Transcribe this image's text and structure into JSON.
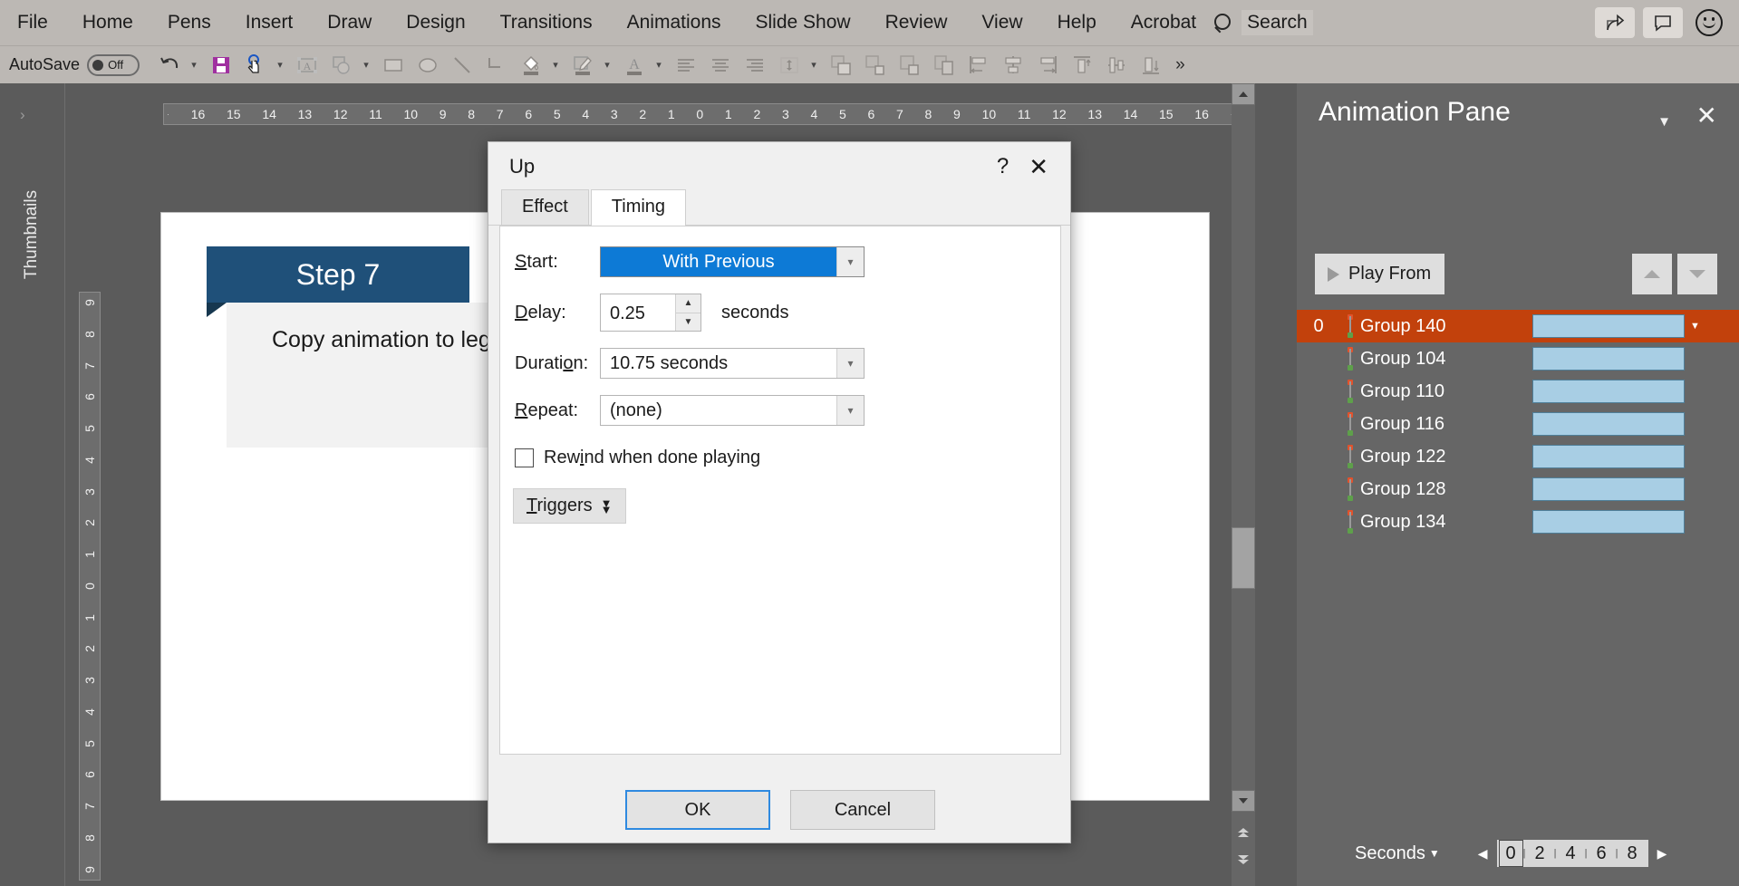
{
  "menu": {
    "items": [
      "File",
      "Home",
      "Pens",
      "Insert",
      "Draw",
      "Design",
      "Transitions",
      "Animations",
      "Slide Show",
      "Review",
      "View",
      "Help",
      "Acrobat"
    ],
    "search_label": "Search",
    "share_icon": "share-icon",
    "comment_icon": "comment-icon",
    "smiley_icon": "smiley-face-icon"
  },
  "toolbar": {
    "autosave_label": "AutoSave",
    "autosave_state": "Off",
    "icons": [
      "undo-icon",
      "save-icon",
      "pointer-hand-icon",
      "text-box-icon",
      "shapes-icon",
      "rectangle-icon",
      "ellipse-icon",
      "line-icon",
      "elbow-connector-icon",
      "shape-fill-icon",
      "shape-outline-icon",
      "text-color-icon",
      "align-left-icon",
      "align-center-icon",
      "align-right-icon",
      "line-spacing-icon",
      "group-icon",
      "bring-forward-icon",
      "send-backward-icon",
      "selection-pane-icon",
      "align-objects-left-icon",
      "align-objects-center-icon",
      "align-objects-right-icon",
      "align-top-icon",
      "align-middle-icon",
      "align-bottom-icon"
    ],
    "overflow_label": "»"
  },
  "left_rail": {
    "label": "Thumbnails",
    "expand_icon": "chevron-right-icon"
  },
  "rulers": {
    "horizontal": [
      "16",
      "15",
      "14",
      "13",
      "12",
      "11",
      "10",
      "9",
      "8",
      "7",
      "6",
      "5",
      "4",
      "3",
      "2",
      "1",
      "0",
      "1",
      "2",
      "3",
      "4",
      "5",
      "6",
      "7",
      "8",
      "9",
      "10",
      "11",
      "12",
      "13",
      "14",
      "15",
      "16"
    ],
    "vertical": [
      "9",
      "8",
      "7",
      "6",
      "5",
      "4",
      "3",
      "2",
      "1",
      "0",
      "1",
      "2",
      "3",
      "4",
      "5",
      "6",
      "7",
      "8",
      "9"
    ]
  },
  "slide": {
    "tag_title": "Step 7",
    "body_text": "Copy animation to legs",
    "tag_color": "#1f5079",
    "body_bg": "#f2f2f2"
  },
  "dialog": {
    "title": "Up",
    "help_glyph": "?",
    "close_glyph": "✕",
    "tabs": [
      {
        "label": "Effect",
        "active": false
      },
      {
        "label": "Timing",
        "active": true
      }
    ],
    "fields": {
      "start_label": "Start:",
      "start_value": "With Previous",
      "delay_label": "Delay:",
      "delay_value": "0.25",
      "delay_unit": "seconds",
      "duration_label": "Duration:",
      "duration_value": "10.75 seconds",
      "repeat_label": "Repeat:",
      "repeat_value": "(none)",
      "rewind_label": "Rewind when done playing",
      "rewind_checked": false,
      "triggers_label": "Triggers"
    },
    "buttons": {
      "ok": "OK",
      "cancel": "Cancel"
    },
    "highlight_color": "#0d7ad6"
  },
  "animation_pane": {
    "title": "Animation Pane",
    "menu_caret_icon": "chevron-down-icon",
    "close_icon": "close-icon",
    "play_label": "Play From",
    "move_up_icon": "triangle-up-icon",
    "move_down_icon": "triangle-down-icon",
    "rows": [
      {
        "index": "0",
        "name": "Group 140",
        "selected": true
      },
      {
        "index": "",
        "name": "Group 104",
        "selected": false
      },
      {
        "index": "",
        "name": "Group 110",
        "selected": false
      },
      {
        "index": "",
        "name": "Group 116",
        "selected": false
      },
      {
        "index": "",
        "name": "Group 122",
        "selected": false
      },
      {
        "index": "",
        "name": "Group 128",
        "selected": false
      },
      {
        "index": "",
        "name": "Group 134",
        "selected": false
      }
    ],
    "selection_color": "#c2410c",
    "bar_color": "#a8cee4",
    "footer": {
      "seconds_label": "Seconds",
      "scale_ticks": [
        "0",
        "2",
        "4",
        "6",
        "8"
      ],
      "prev_icon": "triangle-left-icon",
      "next_icon": "triangle-right-icon"
    }
  },
  "scrollbar": {
    "up_icon": "scroll-up-icon",
    "down_icon": "scroll-down-icon",
    "prev_slide_icon": "previous-slide-icon",
    "next_slide_icon": "next-slide-icon"
  }
}
